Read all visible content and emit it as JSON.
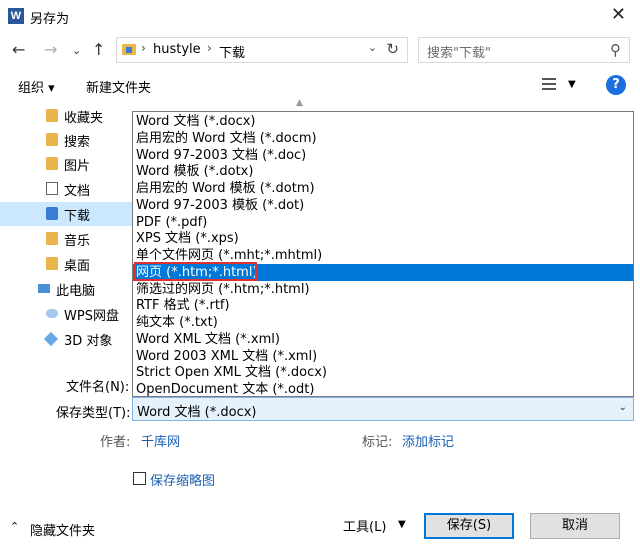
{
  "window": {
    "title": "另存为",
    "app_icon_letter": "W"
  },
  "address": {
    "crumbs": [
      "hustyle",
      "下载"
    ],
    "search_placeholder": "搜索\"下载\""
  },
  "toolbar": {
    "organize": "组织 ▾",
    "new_folder": "新建文件夹"
  },
  "nav": {
    "items": [
      {
        "label": "收藏夹",
        "icon": "star-folder-icon"
      },
      {
        "label": "搜索",
        "icon": "search-folder-icon"
      },
      {
        "label": "图片",
        "icon": "pictures-folder-icon"
      },
      {
        "label": "文档",
        "icon": "documents-icon"
      },
      {
        "label": "下载",
        "icon": "downloads-icon",
        "selected": true
      },
      {
        "label": "音乐",
        "icon": "music-icon"
      },
      {
        "label": "桌面",
        "icon": "desktop-icon"
      },
      {
        "label": "此电脑",
        "icon": "computer-icon"
      },
      {
        "label": "WPS网盘",
        "icon": "cloud-icon"
      },
      {
        "label": "3D 对象",
        "icon": "cube-icon"
      }
    ]
  },
  "file_types": {
    "options": [
      "Word 文档 (*.docx)",
      "启用宏的 Word 文档 (*.docm)",
      "Word 97-2003 文档 (*.doc)",
      "Word 模板 (*.dotx)",
      "启用宏的 Word 模板 (*.dotm)",
      "Word 97-2003 模板 (*.dot)",
      "PDF (*.pdf)",
      "XPS 文档 (*.xps)",
      "单个文件网页 (*.mht;*.mhtml)",
      "网页 (*.htm;*.html)",
      "筛选过的网页 (*.htm;*.html)",
      "RTF 格式 (*.rtf)",
      "纯文本 (*.txt)",
      "Word XML 文档 (*.xml)",
      "Word 2003 XML 文档 (*.xml)",
      "Strict Open XML 文档 (*.docx)",
      "OpenDocument 文本 (*.odt)"
    ],
    "selected_index": 9
  },
  "form": {
    "filename_label": "文件名(N):",
    "savetype_label": "保存类型(T):",
    "savetype_value": "Word 文档 (*.docx)",
    "author_label": "作者:",
    "author_value": "千库网",
    "tags_label": "标记:",
    "tags_value": "添加标记",
    "thumbnail_label": "保存缩略图"
  },
  "footer": {
    "hide_folders": "隐藏文件夹",
    "tools": "工具(L)",
    "save": "保存(S)",
    "cancel": "取消"
  },
  "colors": {
    "selection": "#0078d7",
    "highlight_box": "#e03030",
    "link": "#1a5fb4"
  }
}
